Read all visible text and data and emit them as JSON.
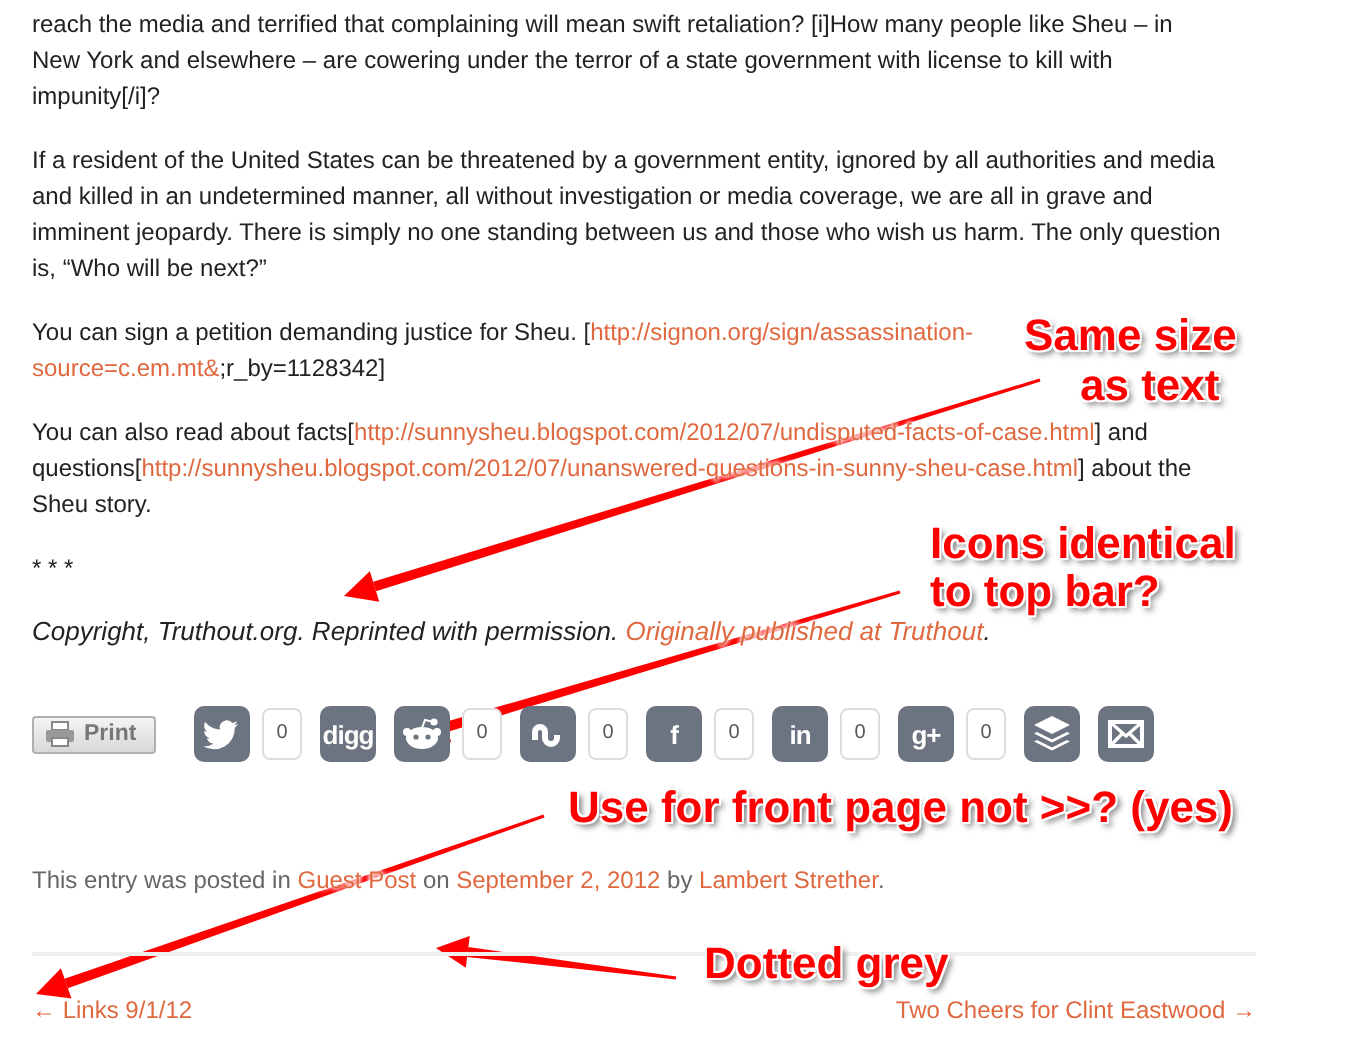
{
  "paragraphs": [
    {
      "segments": [
        {
          "kind": "text",
          "text": "reach the media and terrified that complaining will mean swift retaliation? [i]How many people like Sheu – in New York and elsewhere – are cowering under the terror of a state government with license to kill with impunity[/i]?"
        }
      ]
    },
    {
      "segments": [
        {
          "kind": "text",
          "text": "If a resident of the United States can be threatened by a government entity, ignored by all authorities and media and killed in an undetermined manner, all without investigation or media coverage, we are all in grave and imminent jeopardy. There is simply no one standing between us and those who wish us harm. The only question is, “Who will be next?”"
        }
      ]
    },
    {
      "segments": [
        {
          "kind": "text",
          "text": "You can sign a petition demanding justice for Sheu. ["
        },
        {
          "kind": "link",
          "text": "http://signon.org/sign/assassination-"
        },
        {
          "kind": "break"
        },
        {
          "kind": "link",
          "text": "source=c.em.mt&"
        },
        {
          "kind": "text",
          "text": ";r_by=1128342]"
        }
      ]
    },
    {
      "segments": [
        {
          "kind": "text",
          "text": "You can also read about facts["
        },
        {
          "kind": "link",
          "text": "http://sunnysheu.blogspot.com/2012/07/undisputed-facts-of-case.html"
        },
        {
          "kind": "text",
          "text": "] and questions["
        },
        {
          "kind": "link",
          "text": "http://sunnysheu.blogspot.com/2012/07/unanswered-questions-in-sunny-sheu-case.html"
        },
        {
          "kind": "text",
          "text": "] about the Sheu story."
        }
      ]
    },
    {
      "segments": [
        {
          "kind": "text",
          "text": "* * *"
        }
      ]
    }
  ],
  "copyright": {
    "segments": [
      {
        "kind": "text",
        "text": "Copyright, Truthout.org. Reprinted with permission. "
      },
      {
        "kind": "link",
        "text": "Originally published at Truthout"
      },
      {
        "kind": "text",
        "text": "."
      }
    ]
  },
  "share_bar": {
    "print_label": "Print",
    "buttons": [
      {
        "kind": "twitter",
        "count": "0"
      },
      {
        "kind": "letters",
        "label": "digg"
      },
      {
        "kind": "reddit",
        "count": "0"
      },
      {
        "kind": "stumble",
        "count": "0"
      },
      {
        "kind": "letters",
        "label": "f",
        "count": "0"
      },
      {
        "kind": "letters",
        "label": "in",
        "count": "0"
      },
      {
        "kind": "letters",
        "label": "g+",
        "count": "0"
      },
      {
        "kind": "layers"
      },
      {
        "kind": "mail"
      }
    ]
  },
  "posted": {
    "segments": [
      {
        "kind": "text",
        "text": "This entry was posted in "
      },
      {
        "kind": "link",
        "text": "Guest Post"
      },
      {
        "kind": "text",
        "text": " on "
      },
      {
        "kind": "link",
        "text": "September 2, 2012"
      },
      {
        "kind": "text",
        "text": " by "
      },
      {
        "kind": "link",
        "text": "Lambert Strether"
      },
      {
        "kind": "text",
        "text": "."
      }
    ]
  },
  "post_nav": {
    "previous": "← Links 9/1/12",
    "next": "Two Cheers for Clint Eastwood →"
  },
  "annotations": [
    {
      "lines": [
        "Same size",
        "as text"
      ]
    },
    {
      "lines": [
        "Icons identical",
        "to top bar?"
      ]
    },
    {
      "lines": [
        "Use for front page not >>? (yes)"
      ]
    },
    {
      "lines": [
        "Dotted grey"
      ]
    }
  ]
}
